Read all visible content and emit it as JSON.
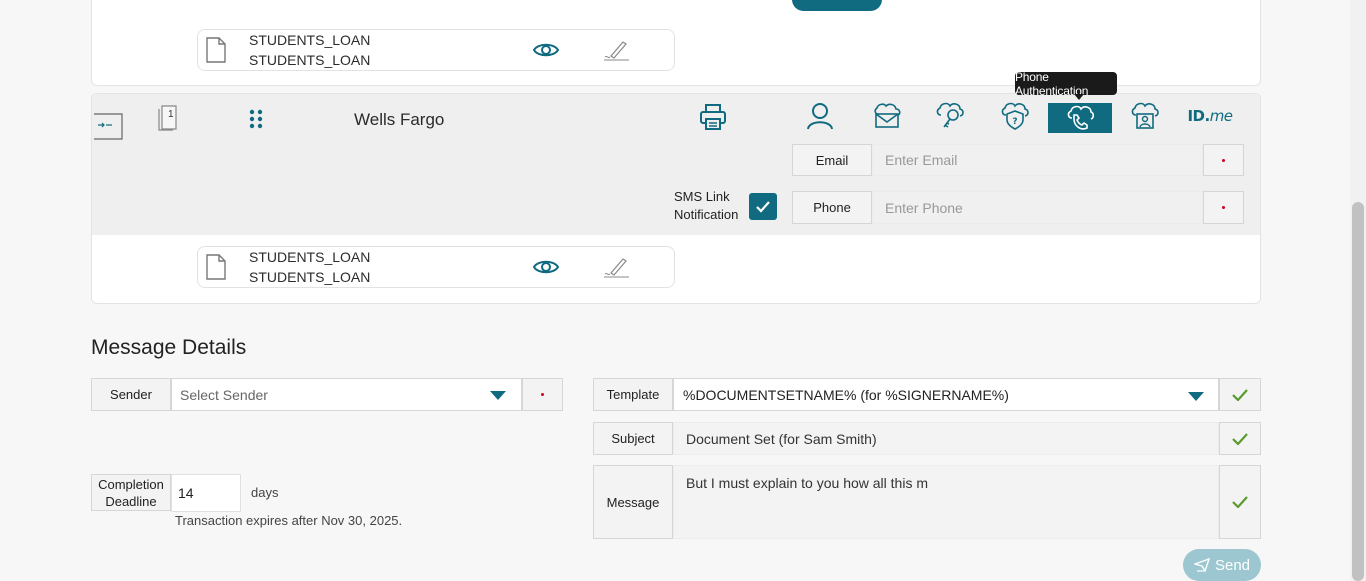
{
  "documents": {
    "top": {
      "line1": "STUDENTS_LOAN",
      "line2": "STUDENTS_LOAN"
    },
    "bottom": {
      "line1": "STUDENTS_LOAN",
      "line2": "STUDENTS_LOAN"
    }
  },
  "signer": {
    "name": "Wells Fargo",
    "order_number": "1",
    "tooltip": "Phone Authentication",
    "idme_label": "ID.",
    "idme_suffix": "me",
    "sms_label_line1": "SMS Link",
    "sms_label_line2": "Notification",
    "sms_checked": true,
    "email_label": "Email",
    "email_placeholder": "Enter Email",
    "phone_label": "Phone",
    "phone_placeholder": "Enter Phone"
  },
  "message_details": {
    "title": "Message Details",
    "sender_label": "Sender",
    "sender_placeholder": "Select Sender",
    "deadline_label_line1": "Completion",
    "deadline_label_line2": "Deadline",
    "deadline_value": "14",
    "deadline_unit": "days",
    "expiry_text": "Transaction expires after Nov 30, 2025.",
    "template_label": "Template",
    "template_value": "%DOCUMENTSETNAME% (for %SIGNERNAME%)",
    "subject_label": "Subject",
    "subject_value": "Document Set (for Sam Smith)",
    "message_label": "Message",
    "message_value": "But I must explain to you how all this m",
    "send_label": "Send"
  },
  "colors": {
    "accent": "#116b80",
    "check_green": "#5a9a2e",
    "required_red": "#d0021b",
    "send_disabled": "#9cc6d0"
  }
}
